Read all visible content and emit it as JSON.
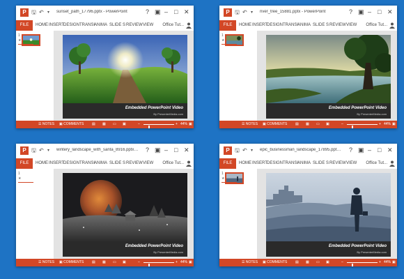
{
  "app": {
    "tabs": [
      "FILE",
      "HOME",
      "INSERT",
      "DESIGN",
      "TRANSI",
      "ANIMA",
      "SLIDE S",
      "REVIEW",
      "VIEW"
    ],
    "account_label": "Office Tut...",
    "status": {
      "notes_label": "NOTES",
      "comments_label": "COMMENTS",
      "zoom": "44%"
    },
    "slide_number": "1",
    "caption_title": "Embedded PowerPoint Video",
    "caption_sub": "By PresenterMedia.com",
    "accent_color": "#d24726",
    "desktop_color": "#1e73c4"
  },
  "windows": [
    {
      "title": "sunset_path_17796.pptx - PowerPoint",
      "scene": "sunset-path"
    },
    {
      "title": "river_tree_15881.pptx - PowerPoint",
      "scene": "river-tree"
    },
    {
      "title": "wintery_landscape_with_santa_8916.pptx - ...",
      "scene": "winter-santa"
    },
    {
      "title": "epic_businessman_landscape_17895.pptx - ...",
      "scene": "businessman"
    }
  ]
}
